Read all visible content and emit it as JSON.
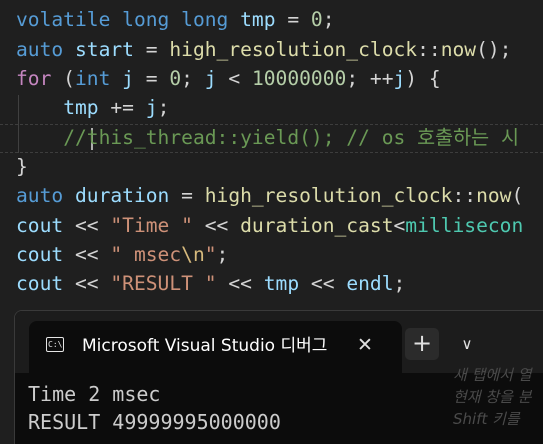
{
  "editor": {
    "lines": [
      [
        [
          "kw",
          "volatile"
        ],
        [
          "op",
          " "
        ],
        [
          "kw",
          "long long"
        ],
        [
          "op",
          " "
        ],
        [
          "id",
          "tmp"
        ],
        [
          "op",
          " = "
        ],
        [
          "num",
          "0"
        ],
        [
          "op",
          ";"
        ]
      ],
      [
        [
          "kw",
          "auto"
        ],
        [
          "op",
          " "
        ],
        [
          "id",
          "start"
        ],
        [
          "op",
          " = "
        ],
        [
          "fn",
          "high_resolution_clock"
        ],
        [
          "op",
          "::"
        ],
        [
          "fn",
          "now"
        ],
        [
          "op",
          "();"
        ]
      ],
      [
        [
          "kw2",
          "for"
        ],
        [
          "op",
          " ("
        ],
        [
          "kw",
          "int"
        ],
        [
          "op",
          " "
        ],
        [
          "id",
          "j"
        ],
        [
          "op",
          " = "
        ],
        [
          "num",
          "0"
        ],
        [
          "op",
          "; "
        ],
        [
          "id",
          "j"
        ],
        [
          "op",
          " < "
        ],
        [
          "num",
          "10000000"
        ],
        [
          "op",
          "; ++"
        ],
        [
          "id",
          "j"
        ],
        [
          "op",
          ") {"
        ]
      ],
      [
        [
          "op",
          "    "
        ],
        [
          "id",
          "tmp"
        ],
        [
          "op",
          " += "
        ],
        [
          "id",
          "j"
        ],
        [
          "op",
          ";"
        ]
      ],
      [
        [
          "op",
          "    "
        ],
        [
          "cm",
          "//this_thread::yield(); // os 호출하는 시"
        ]
      ],
      [
        [
          "op",
          "}"
        ]
      ],
      [
        [
          "kw",
          "auto"
        ],
        [
          "op",
          " "
        ],
        [
          "id",
          "duration"
        ],
        [
          "op",
          " = "
        ],
        [
          "fn",
          "high_resolution_clock"
        ],
        [
          "op",
          "::"
        ],
        [
          "fn",
          "now"
        ],
        [
          "op",
          "("
        ]
      ],
      [
        [
          "id",
          "cout"
        ],
        [
          "op",
          " << "
        ],
        [
          "str",
          "\"Time \""
        ],
        [
          "op",
          " << "
        ],
        [
          "fn",
          "duration_cast"
        ],
        [
          "op",
          "<"
        ],
        [
          "ty",
          "millisecon"
        ]
      ],
      [
        [
          "id",
          "cout"
        ],
        [
          "op",
          " << "
        ],
        [
          "str",
          "\" msec"
        ],
        [
          "esc",
          "\\n"
        ],
        [
          "str",
          "\""
        ],
        [
          "op",
          ";"
        ]
      ],
      [
        [
          "id",
          "cout"
        ],
        [
          "op",
          " << "
        ],
        [
          "str",
          "\"RESULT \""
        ],
        [
          "op",
          " << "
        ],
        [
          "id",
          "tmp"
        ],
        [
          "op",
          " << "
        ],
        [
          "id",
          "endl"
        ],
        [
          "op",
          ";"
        ]
      ]
    ]
  },
  "terminal": {
    "tab_title": "Microsoft Visual Studio 디버그",
    "icon_glyph": "C:\\",
    "close_glyph": "✕",
    "new_tab_glyph": "+",
    "dropdown_glyph": "∨",
    "output": [
      "Time 2 msec",
      "RESULT 49999995000000"
    ],
    "ghost_hint": [
      "새 탭에서 열",
      "현재 창을 분",
      "Shift 키를"
    ]
  },
  "icons": {
    "tab_icon": "console-app-icon",
    "close": "close-icon",
    "new_tab": "plus-icon",
    "dropdown": "chevron-down-icon"
  },
  "colors": {
    "editor_bg": "#1f1f1f",
    "terminal_bg": "#0c0c0c",
    "keyword": "#569cd6",
    "control": "#c586c0",
    "variable": "#9cdcfe",
    "function": "#dcdcaa",
    "type": "#4ec9b0",
    "number": "#b5cea8",
    "string": "#ce9178",
    "comment": "#6a9955"
  }
}
